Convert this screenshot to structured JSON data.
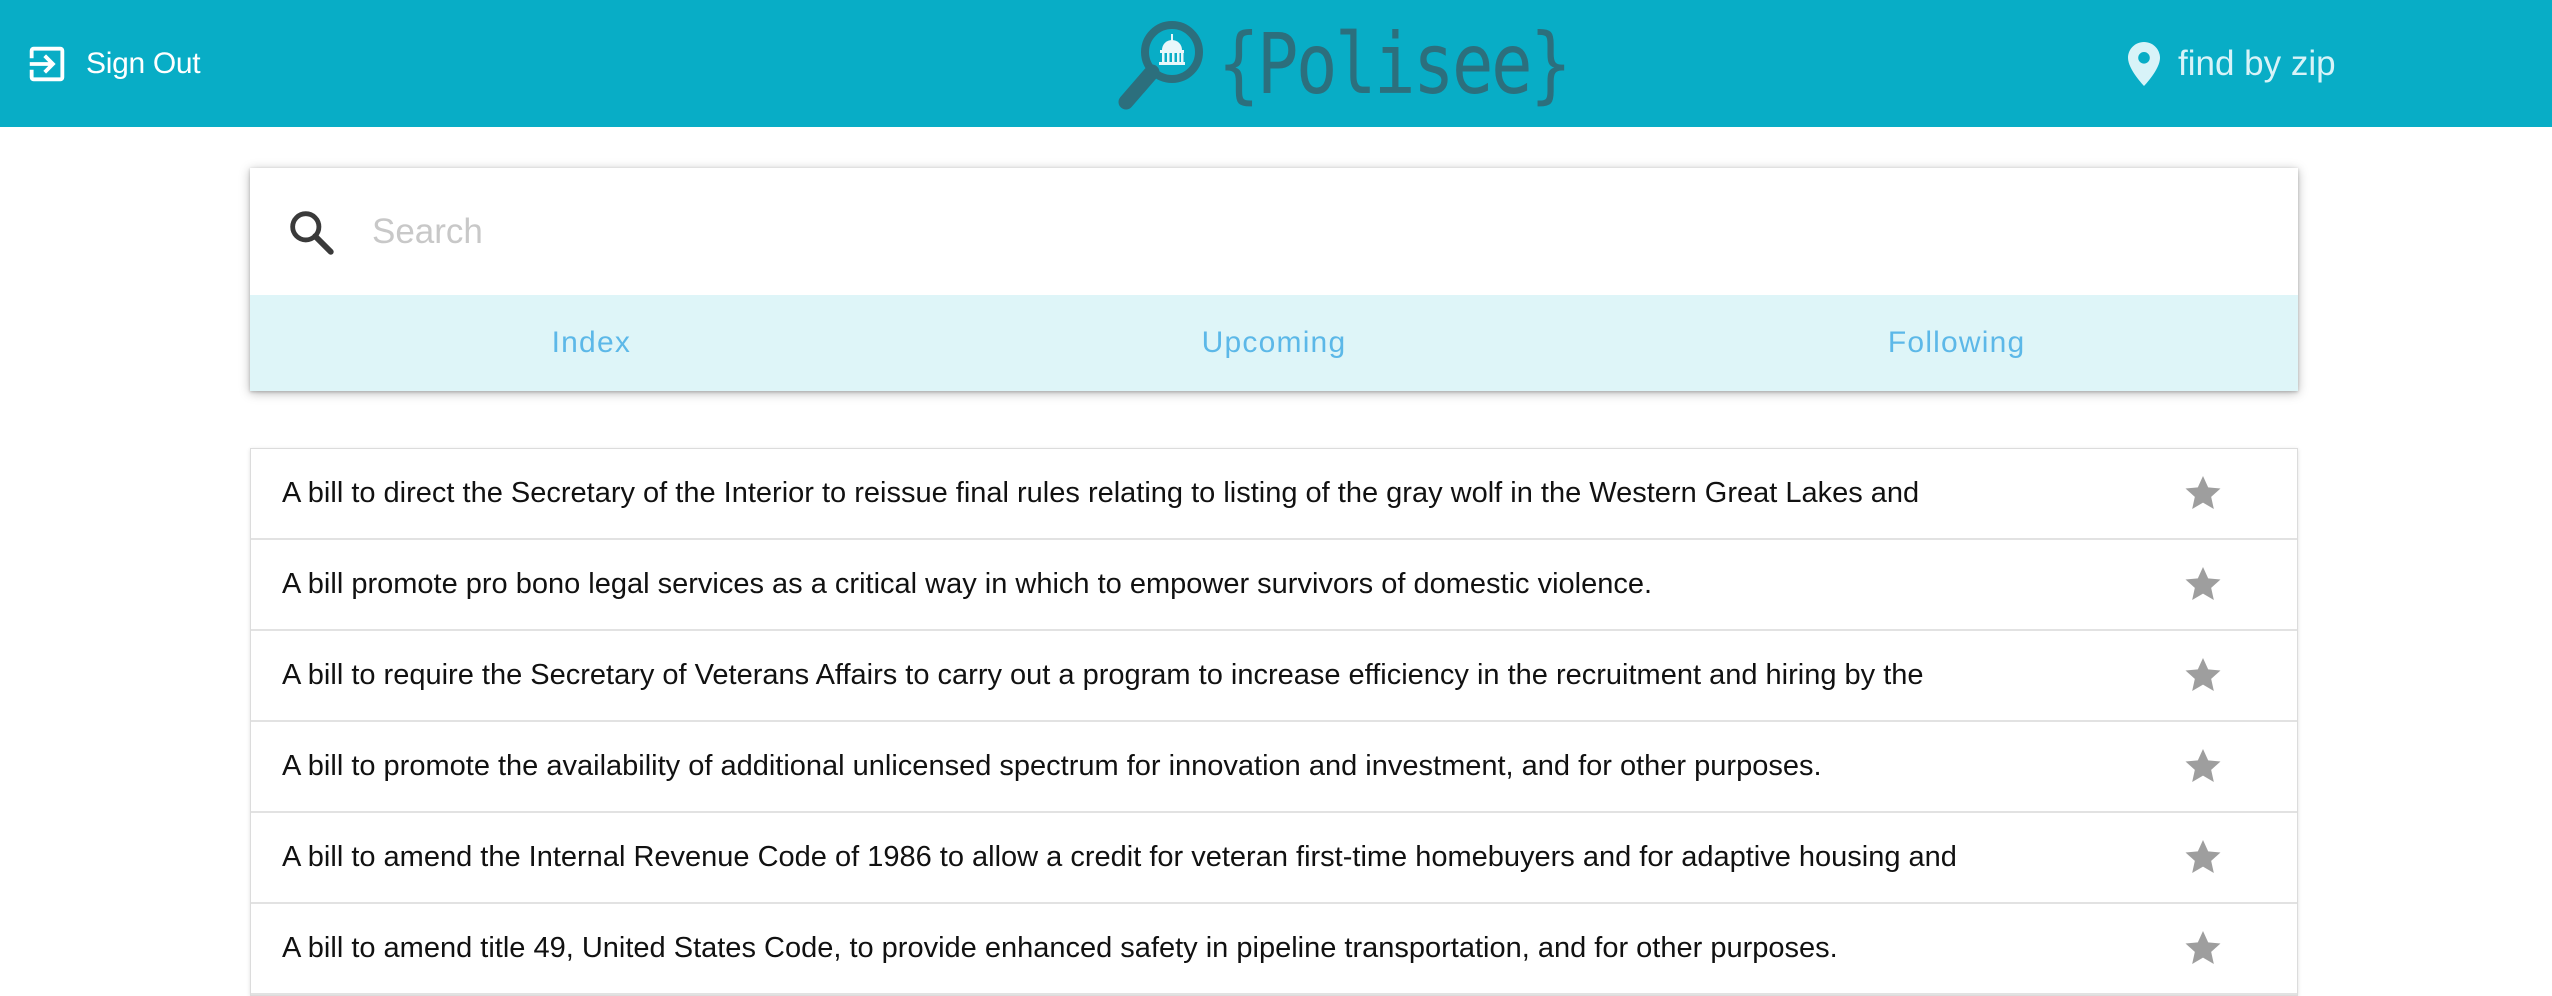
{
  "header": {
    "signout_label": "Sign Out",
    "logo_text": "{Polisee}",
    "findzip_label": "find by zip",
    "background": "#08adc6"
  },
  "search": {
    "placeholder": "Search",
    "value": ""
  },
  "tabs": [
    {
      "label": "Index"
    },
    {
      "label": "Upcoming"
    },
    {
      "label": "Following"
    }
  ],
  "bills": [
    {
      "text": "A bill to direct the Secretary of the Interior to reissue final rules relating to listing of the gray wolf in the Western Great Lakes and"
    },
    {
      "text": "A bill promote pro bono legal services as a critical way in which to empower survivors of domestic violence."
    },
    {
      "text": "A bill to require the Secretary of Veterans Affairs to carry out a program to increase efficiency in the recruitment and hiring by the"
    },
    {
      "text": "A bill to promote the availability of additional unlicensed spectrum for innovation and investment, and for other purposes."
    },
    {
      "text": "A bill to amend the Internal Revenue Code of 1986 to allow a credit for veteran first-time homebuyers and for adaptive housing and"
    },
    {
      "text": "A bill to amend title 49, United States Code, to provide enhanced safety in pipeline transportation, and for other purposes."
    }
  ],
  "icons": {
    "signout": "sign-out-icon",
    "logo": "magnifier-capitol-icon",
    "location": "location-pin-icon",
    "search": "search-icon",
    "star": "star-icon"
  },
  "colors": {
    "accent": "#08adc6",
    "tab_bg": "#def5f8",
    "tab_text": "#5cb8e8",
    "star": "#9e9e9e"
  }
}
